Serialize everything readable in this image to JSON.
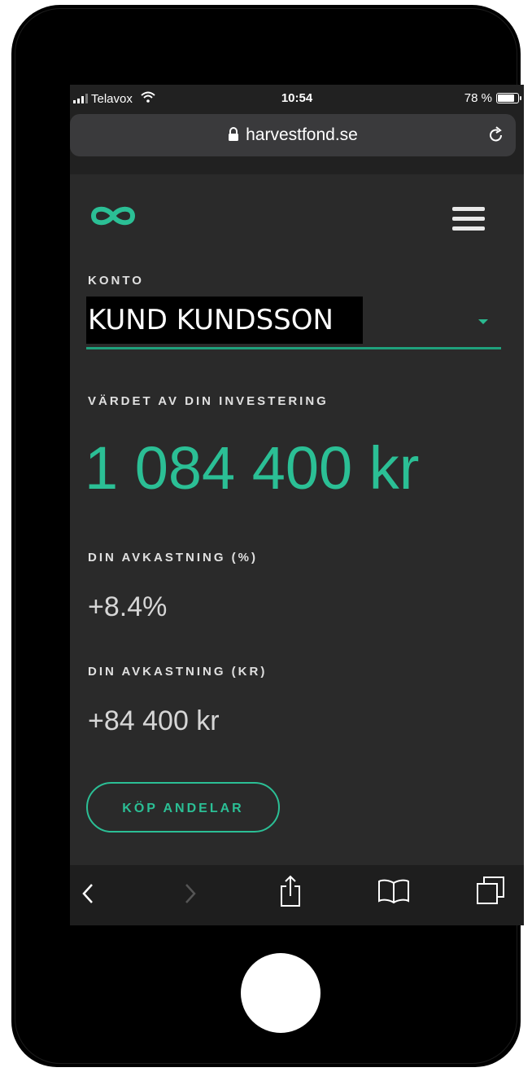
{
  "status_bar": {
    "carrier": "Telavox",
    "time": "10:54",
    "battery": "78 %",
    "battery_level": 0.78
  },
  "browser": {
    "url": "harvestfond.se"
  },
  "account": {
    "label": "KONTO",
    "selected": "KUND KUNDSSON"
  },
  "investment": {
    "label": "VÄRDET AV DIN INVESTERING",
    "value": "1 084 400 kr"
  },
  "return_pct": {
    "label": "DIN AVKASTNING (%)",
    "value": "+8.4%"
  },
  "return_kr": {
    "label": "DIN AVKASTNING (KR)",
    "value": "+84 400 kr"
  },
  "buy_button": {
    "label": "KÖP ANDELAR"
  },
  "icons": {
    "logo": "infinity-logo-icon",
    "menu": "hamburger-menu-icon",
    "lock": "lock-icon",
    "reload": "reload-icon",
    "back": "back-arrow-icon",
    "forward": "forward-arrow-icon",
    "share": "share-icon",
    "bookmarks": "bookmarks-icon",
    "tabs": "tabs-icon"
  },
  "colors": {
    "accent": "#2bbf95",
    "background": "#2a2a2a"
  }
}
